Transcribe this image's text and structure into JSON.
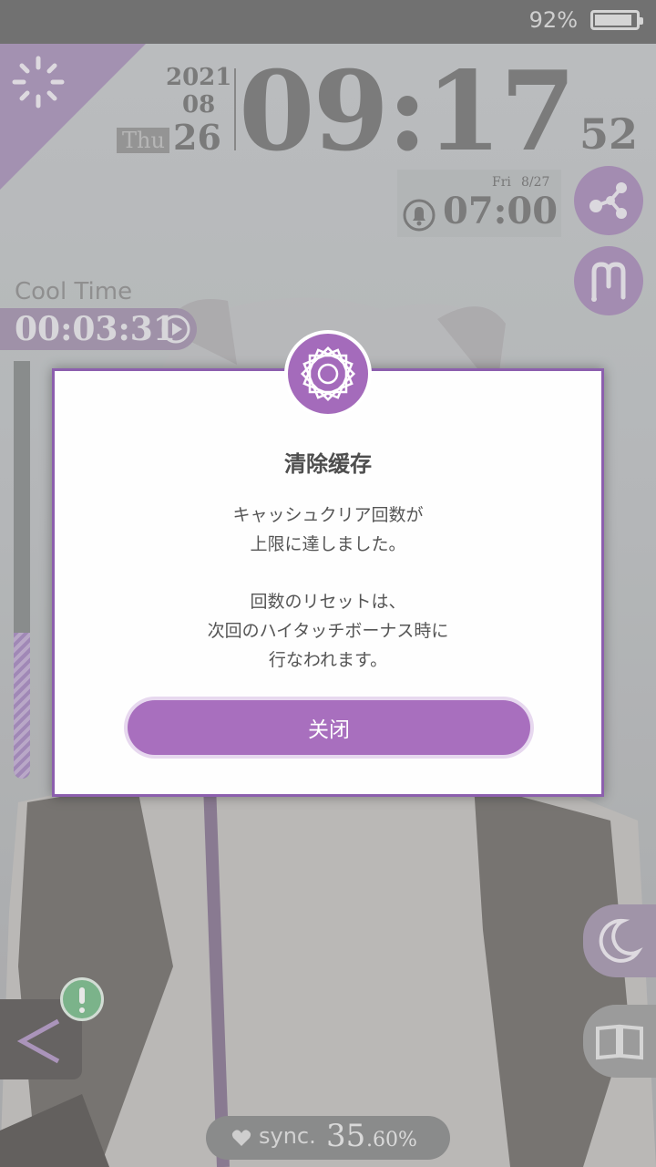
{
  "status_bar": {
    "battery_percent": "92%",
    "battery_level": 0.92
  },
  "clock": {
    "year": "2021",
    "month": "08",
    "weekday": "Thu",
    "day": "26",
    "time": "09:17",
    "seconds": "52"
  },
  "alarm": {
    "date_day": "Fri",
    "date": "8/27",
    "time": "07:00"
  },
  "cool_time": {
    "label": "Cool Time",
    "value": "00:03:31",
    "gauge_level": 0.35
  },
  "dialog": {
    "title": "清除缓存",
    "message_lines": [
      "キャッシュクリア回数が",
      "上限に達しました。",
      "回数のリセットは、",
      "次回のハイタッチボーナス時に",
      "行なわれます。"
    ],
    "close_label": "关闭"
  },
  "sync": {
    "label": "sync.",
    "value_int": "35",
    "value_dec": ".60%"
  },
  "icons": [
    "brightness-icon",
    "share-icon",
    "menu-m-icon",
    "play-icon",
    "bell-icon",
    "back-icon",
    "alert-icon",
    "moon-icon",
    "book-icon",
    "heart-icon",
    "emblem-icon"
  ],
  "colors": {
    "accent": "#a86fbe",
    "dialog_border": "#8c5fae",
    "status_bar": "#707070"
  }
}
